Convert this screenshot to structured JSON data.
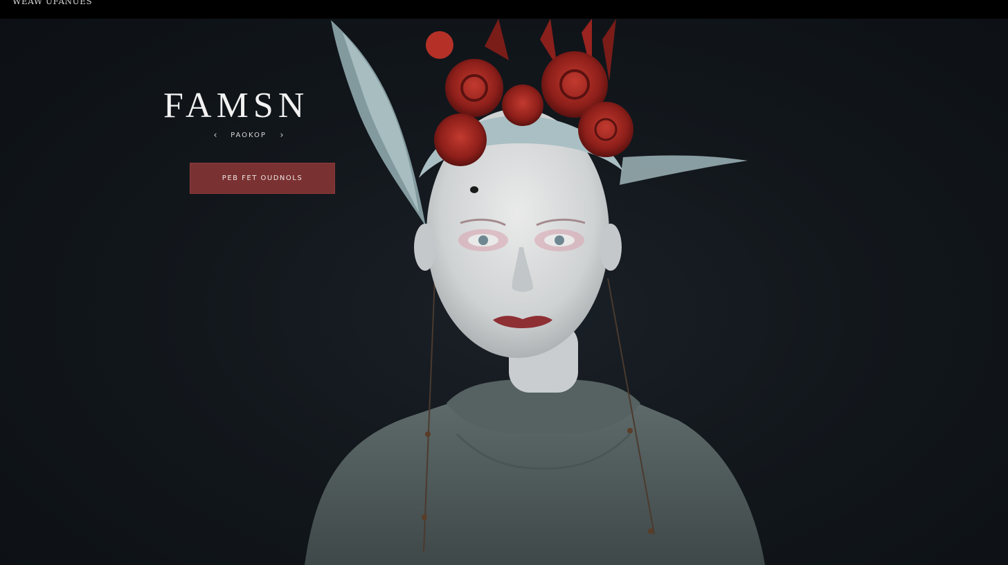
{
  "topbar": {
    "text": "WEAW UFANUES"
  },
  "hero": {
    "title": "FAMSN",
    "nav": {
      "prev_icon": "chevron-left-icon",
      "label": "PAOKOP",
      "next_icon": "chevron-right-icon"
    },
    "cta_label": "PEB FET OUDNOLS"
  },
  "colors": {
    "background": "#11161b",
    "topbar": "#000000",
    "accent": "#7a3131",
    "title": "#f2f2f2"
  }
}
